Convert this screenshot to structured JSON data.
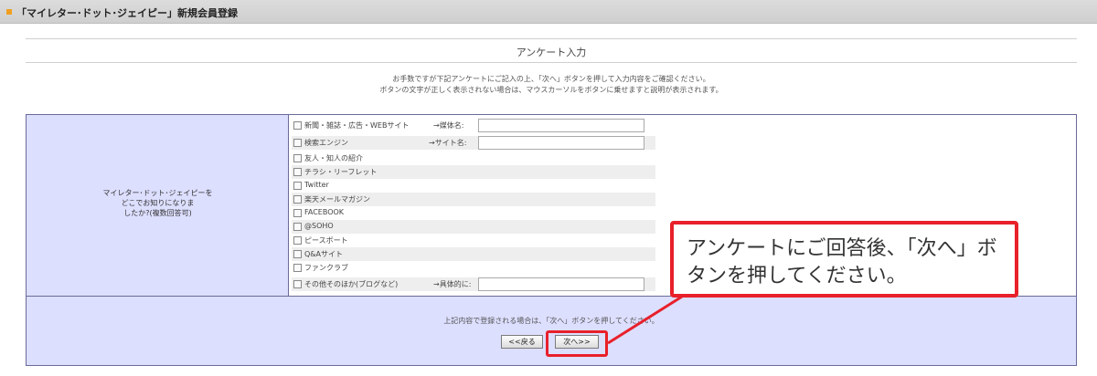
{
  "header": {
    "title": "「マイレター･ドット･ジェイピー」新規会員登録"
  },
  "section": {
    "title": "アンケート入力"
  },
  "intro": {
    "line1": "お手数ですが下記アンケートにご記入の上、「次へ」ボタンを押して入力内容をご確認ください。",
    "line2": "ボタンの文字が正しく表示されない場合は、マウスカーソルをボタンに乗せますと説明が表示されます。"
  },
  "question": {
    "line1": "マイレター･ドット･ジェイピーを",
    "line2": "どこでお知りになりま",
    "line3": "したか?(複数回答可)"
  },
  "options": [
    {
      "label": "新聞・雑誌・広告・WEBサイト",
      "checked": false,
      "input_label": "→媒体名:",
      "input_value": ""
    },
    {
      "label": "検索エンジン",
      "checked": false,
      "input_label": "→サイト名:",
      "input_value": ""
    },
    {
      "label": "友人・知人の紹介",
      "checked": false
    },
    {
      "label": "チラシ・リーフレット",
      "checked": false
    },
    {
      "label": "Twitter",
      "checked": false
    },
    {
      "label": "楽天メールマガジン",
      "checked": false
    },
    {
      "label": "FACEBOOK",
      "checked": false
    },
    {
      "label": "@SOHO",
      "checked": false
    },
    {
      "label": "ピースボート",
      "checked": false
    },
    {
      "label": "Q&Aサイト",
      "checked": false
    },
    {
      "label": "ファンクラブ",
      "checked": false
    },
    {
      "label": "その他そのほか(ブログなど)",
      "checked": false,
      "input_label": "→具体的に:",
      "input_value": ""
    }
  ],
  "submit": {
    "note": "上記内容で登録される場合は、「次へ」ボタンを押してください。",
    "back_label": "<<戻る",
    "next_label": "次へ>>"
  },
  "callout": {
    "text": "アンケートにご回答後、「次へ」ボタンを押してください。"
  },
  "colors": {
    "highlight": "#e8202a",
    "cell_bg": "#dddfff",
    "bullet": "#f0a020"
  }
}
